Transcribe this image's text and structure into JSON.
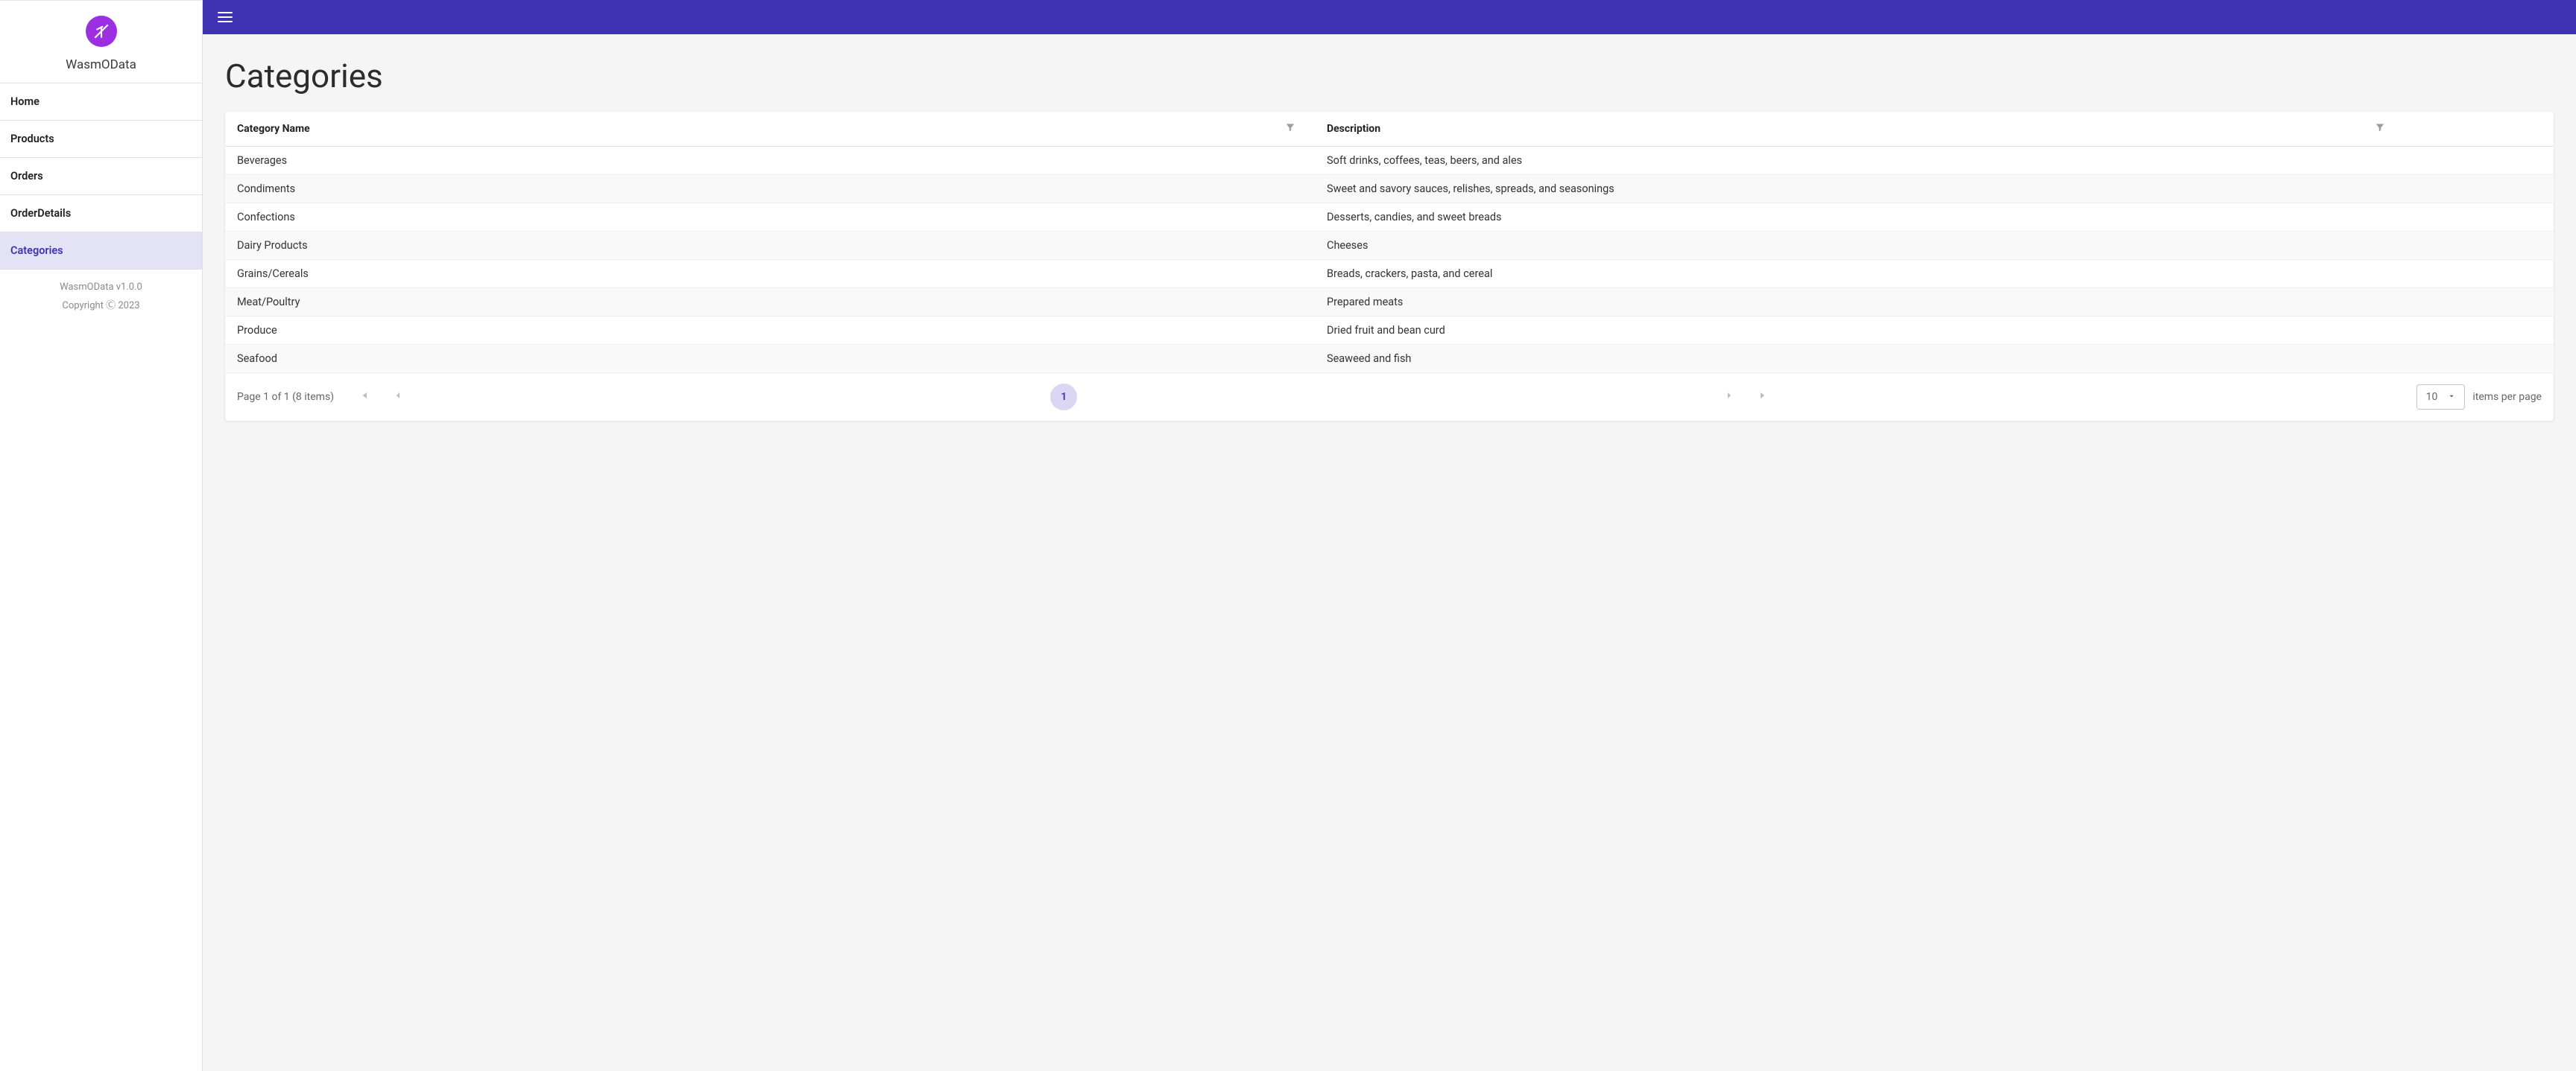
{
  "brand": {
    "name": "WasmOData"
  },
  "sidebar": {
    "items": [
      {
        "label": "Home",
        "active": false
      },
      {
        "label": "Products",
        "active": false
      },
      {
        "label": "Orders",
        "active": false
      },
      {
        "label": "OrderDetails",
        "active": false
      },
      {
        "label": "Categories",
        "active": true
      }
    ],
    "footer": {
      "version": "WasmOData v1.0.0",
      "copyright": "Copyright Ⓒ 2023"
    }
  },
  "page": {
    "title": "Categories"
  },
  "table": {
    "columns": [
      {
        "header": "Category Name"
      },
      {
        "header": "Description"
      }
    ],
    "rows": [
      {
        "name": "Beverages",
        "desc": "Soft drinks, coffees, teas, beers, and ales"
      },
      {
        "name": "Condiments",
        "desc": "Sweet and savory sauces, relishes, spreads, and seasonings"
      },
      {
        "name": "Confections",
        "desc": "Desserts, candies, and sweet breads"
      },
      {
        "name": "Dairy Products",
        "desc": "Cheeses"
      },
      {
        "name": "Grains/Cereals",
        "desc": "Breads, crackers, pasta, and cereal"
      },
      {
        "name": "Meat/Poultry",
        "desc": "Prepared meats"
      },
      {
        "name": "Produce",
        "desc": "Dried fruit and bean curd"
      },
      {
        "name": "Seafood",
        "desc": "Seaweed and fish"
      }
    ]
  },
  "pager": {
    "status": "Page 1 of 1 (8 items)",
    "current_page": "1",
    "page_size": "10",
    "suffix": "items per page"
  }
}
